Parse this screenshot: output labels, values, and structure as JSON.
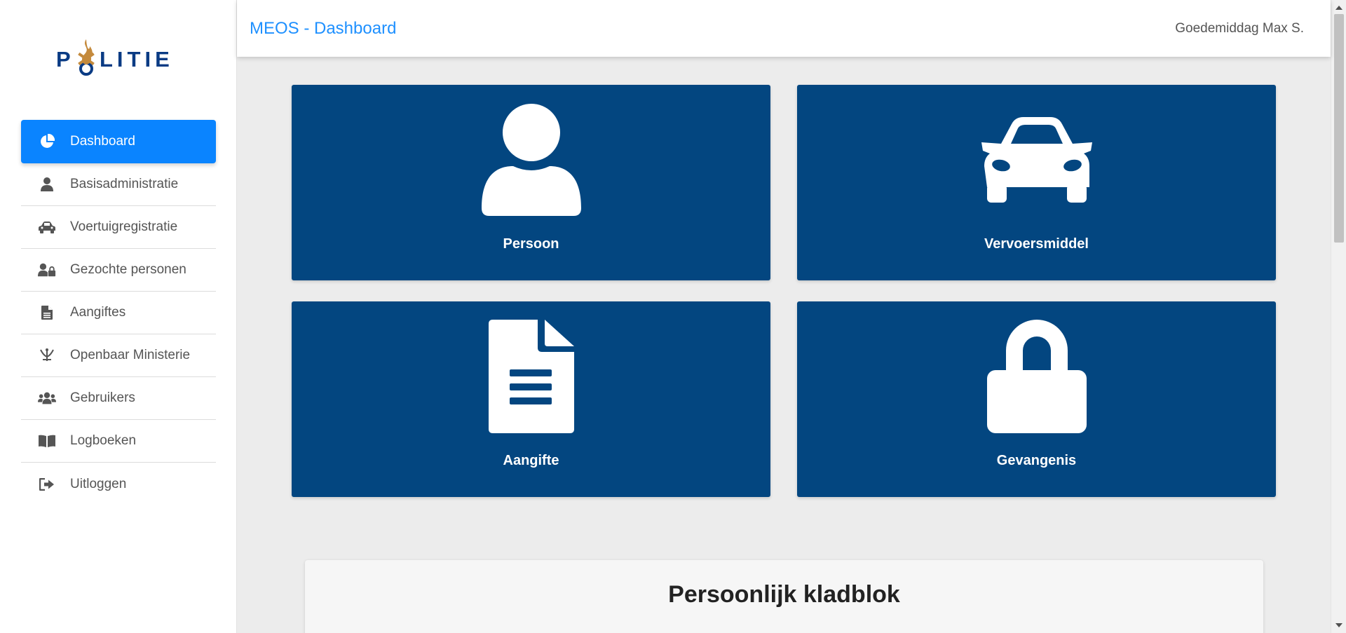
{
  "header": {
    "title": "MEOS - Dashboard",
    "greeting": "Goedemiddag Max S."
  },
  "logo": {
    "text": "POLITIE",
    "colors": {
      "text": "#0a3b84",
      "emblem": "#c48a3c"
    }
  },
  "sidebar": {
    "items": [
      {
        "label": "Dashboard",
        "icon": "pie-chart-icon",
        "active": true
      },
      {
        "label": "Basisadministratie",
        "icon": "user-icon",
        "active": false
      },
      {
        "label": "Voertuigregistratie",
        "icon": "car-icon",
        "active": false
      },
      {
        "label": "Gezochte personen",
        "icon": "user-lock-icon",
        "active": false
      },
      {
        "label": "Aangiftes",
        "icon": "file-icon",
        "active": false
      },
      {
        "label": "Openbaar Ministerie",
        "icon": "om-emblem-icon",
        "active": false
      },
      {
        "label": "Gebruikers",
        "icon": "users-icon",
        "active": false
      },
      {
        "label": "Logboeken",
        "icon": "book-icon",
        "active": false
      },
      {
        "label": "Uitloggen",
        "icon": "sign-out-icon",
        "active": false
      }
    ]
  },
  "tiles": [
    {
      "label": "Persoon",
      "icon": "user-icon"
    },
    {
      "label": "Vervoersmiddel",
      "icon": "car-icon"
    },
    {
      "label": "Aangifte",
      "icon": "file-alt-icon"
    },
    {
      "label": "Gevangenis",
      "icon": "lock-icon"
    }
  ],
  "notepad": {
    "title": "Persoonlijk kladblok"
  },
  "colors": {
    "accent": "#0a84ff",
    "header_title": "#1e90ff",
    "tile_background": "#034680",
    "page_background": "#ececec"
  }
}
